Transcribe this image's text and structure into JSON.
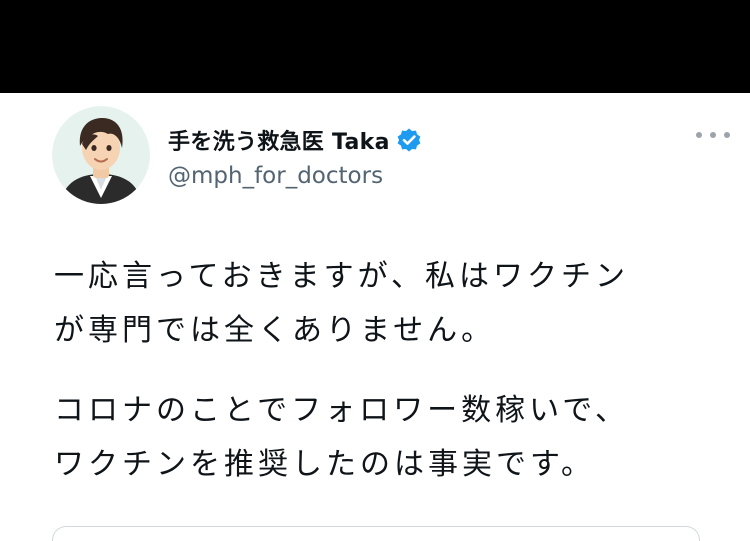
{
  "tweet": {
    "display_name": "手を洗う救急医 Taka",
    "handle": "@mph_for_doctors",
    "verified_icon": "verified-badge-icon",
    "more_icon": "more-options-icon",
    "avatar_icon": "profile-avatar",
    "lines": [
      "一応言っておきますが、私はワクチン",
      "が専門では全くありません。",
      "コロナのことでフォロワー数稼いで、",
      "ワクチンを推奨したのは事実です。"
    ]
  },
  "colors": {
    "background": "#000000",
    "card": "#ffffff",
    "text": "#0f1419",
    "secondary": "#536471",
    "verified": "#1d9bf0"
  }
}
